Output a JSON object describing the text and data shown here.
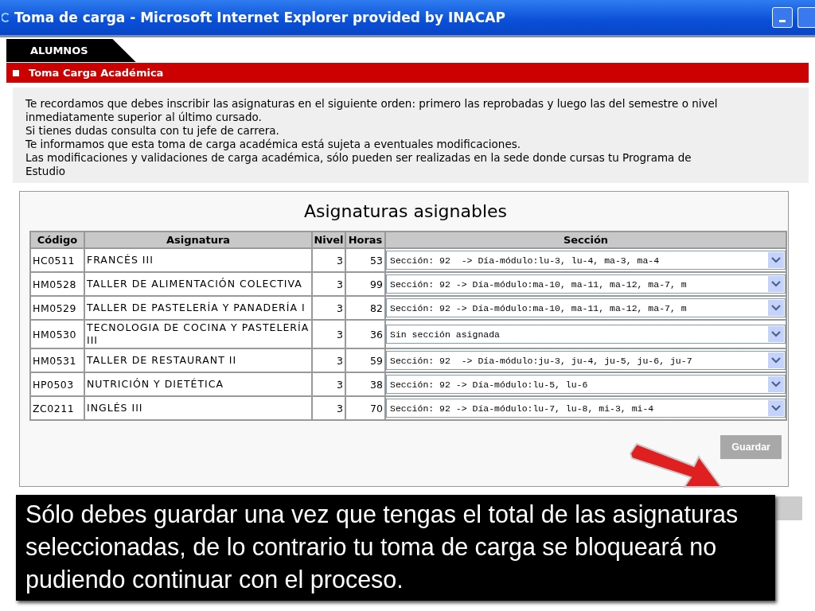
{
  "window": {
    "title": "Toma de carga - Microsoft Internet Explorer provided by INACAP"
  },
  "nav": {
    "tab": "ALUMNOS",
    "section": "Toma Carga Académica"
  },
  "notice": [
    "Te recordamos que debes inscribir las asignaturas en el siguiente orden: primero las reprobadas y luego las del semestre o nivel inmediatamente superior al último cursado.",
    "Si tienes dudas consulta con tu jefe de carrera.",
    "Te informamos que esta toma de carga académica está sujeta a eventuales modificaciones.",
    "Las modificaciones y validaciones de carga académica, sólo pueden ser realizadas en la sede donde cursas tu Programa de Estudio"
  ],
  "panel": {
    "title": "Asignaturas asignables"
  },
  "table": {
    "columns": [
      "Código",
      "Asignatura",
      "Nivel",
      "Horas",
      "Sección"
    ],
    "rows": [
      {
        "code": "HC0511",
        "subject": "FRANCÉS III",
        "level": "3",
        "hours": "53",
        "section": "Sección: 92  -> Día-módulo:lu-3, lu-4, ma-3, ma-4"
      },
      {
        "code": "HM0528",
        "subject": "TALLER DE ALIMENTACIÓN COLECTIVA",
        "level": "3",
        "hours": "99",
        "section": "Sección: 92 -> Día-módulo:ma-10, ma-11, ma-12, ma-7, m"
      },
      {
        "code": "HM0529",
        "subject": "TALLER DE PASTELERÍA Y PANADERÍA I",
        "level": "3",
        "hours": "82",
        "section": "Sección: 92 -> Día-módulo:ma-10, ma-11, ma-12, ma-7, m"
      },
      {
        "code": "HM0530",
        "subject": "TECNOLOGIA DE COCINA Y PASTELERÍA III",
        "level": "3",
        "hours": "36",
        "section": "Sin sección asignada"
      },
      {
        "code": "HM0531",
        "subject": "TALLER DE RESTAURANT II",
        "level": "3",
        "hours": "59",
        "section": "Sección: 92  -> Día-módulo:ju-3, ju-4, ju-5, ju-6, ju-7"
      },
      {
        "code": "HP0503",
        "subject": "NUTRICIÓN Y DIETÉTICA",
        "level": "3",
        "hours": "38",
        "section": "Sección: 92 -> Día-módulo:lu-5, lu-6"
      },
      {
        "code": "ZC0211",
        "subject": "INGLÉS III",
        "level": "3",
        "hours": "70",
        "section": "Sección: 92 -> Día-módulo:lu-7, lu-8, mi-3, mi-4"
      }
    ]
  },
  "save_button": "Guardar",
  "callout": "Sólo debes guardar una vez que tengas el total de las asignaturas seleccionadas, de lo contrario tu toma de carga se bloqueará no pudiendo continuar con el proceso."
}
